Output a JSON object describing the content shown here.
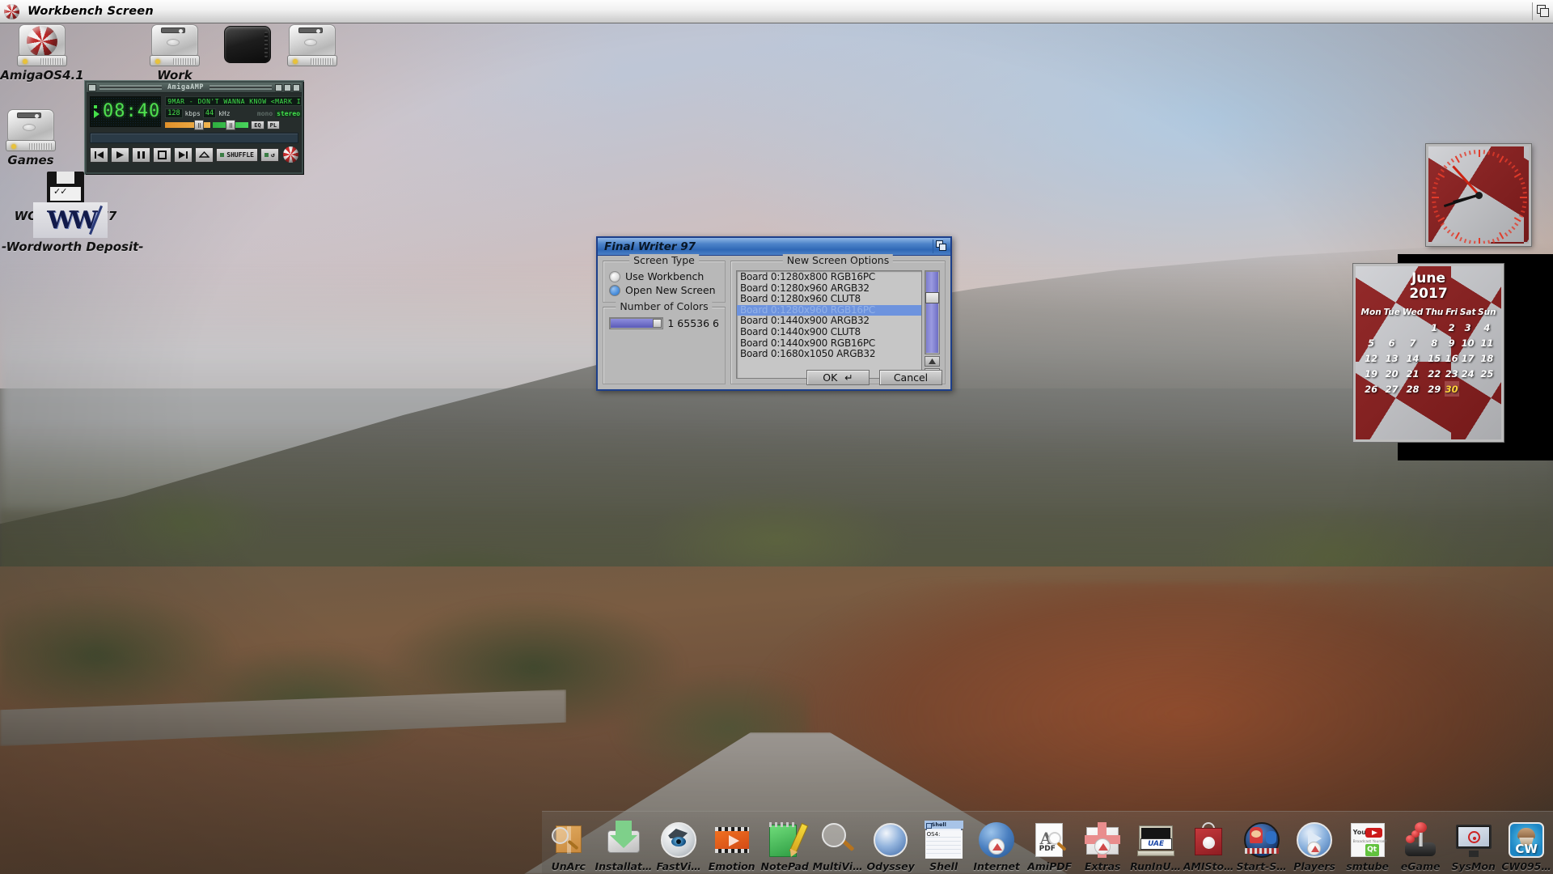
{
  "screen": {
    "title": "Workbench Screen",
    "title_icon": "amiga-ball-icon",
    "depth_gadget": "depth-gadget-icon"
  },
  "desktop_icons": [
    {
      "label": "AmigaOS4.1",
      "icon": "harddisk-amigaball-icon"
    },
    {
      "label": "Work",
      "icon": "harddisk-icon"
    },
    {
      "label": "Games",
      "icon": "harddisk-icon"
    },
    {
      "label": "WORDWORTH7",
      "icon": "floppy-disk-icon"
    },
    {
      "label": "-Wordworth Deposit-",
      "icon": "wordworth-logo-icon"
    }
  ],
  "amigaamp": {
    "window_title": "AmigaAMP",
    "time": "08:40",
    "track": "9MAR - DON'T WANNA KNOW <MARK I",
    "bitrate": "128",
    "bitrate_unit": "kbps",
    "samplerate": "44",
    "samplerate_unit": "kHz",
    "mono_label": "mono",
    "stereo_label": "stereo",
    "eq_label": "EQ",
    "pl_label": "PL",
    "shuffle_label": "SHUFFLE",
    "repeat_label": "↺",
    "buttons": [
      "prev-track",
      "play",
      "pause",
      "stop",
      "next-track",
      "eject"
    ]
  },
  "dialog": {
    "title": "Final Writer 97",
    "screen_type": {
      "legend": "Screen Type",
      "options": [
        {
          "label": "Use Workbench",
          "selected": false
        },
        {
          "label": "Open New Screen",
          "selected": true
        }
      ]
    },
    "number_of_colors": {
      "legend": "Number of Colors",
      "value_text": "1 65536 6"
    },
    "new_screen_options": {
      "legend": "New Screen Options",
      "items": [
        {
          "label": "Board 0:1280x800 RGB16PC",
          "selected": false
        },
        {
          "label": "Board 0:1280x960 ARGB32",
          "selected": false
        },
        {
          "label": "Board 0:1280x960 CLUT8",
          "selected": false
        },
        {
          "label": "Board 0:1280x960 RGB16PC",
          "selected": true
        },
        {
          "label": "Board 0:1440x900 ARGB32",
          "selected": false
        },
        {
          "label": "Board 0:1440x900 CLUT8",
          "selected": false
        },
        {
          "label": "Board 0:1440x900 RGB16PC",
          "selected": false
        },
        {
          "label": "Board 0:1680x1050 ARGB32",
          "selected": false
        }
      ]
    },
    "ok_label": "OK",
    "ok_glyph": "↵",
    "cancel_label": "Cancel"
  },
  "clock": {
    "hour_angle": 255,
    "minute_angle": 252,
    "second_angle": 318
  },
  "calendar": {
    "month": "June",
    "year": "2017",
    "weekdays": [
      "Mon",
      "Tue",
      "Wed",
      "Thu",
      "Fri",
      "Sat",
      "Sun"
    ],
    "weeks": [
      [
        "",
        "",
        "",
        "1",
        "2",
        "3",
        "4"
      ],
      [
        "5",
        "6",
        "7",
        "8",
        "9",
        "10",
        "11"
      ],
      [
        "12",
        "13",
        "14",
        "15",
        "16",
        "17",
        "18"
      ],
      [
        "19",
        "20",
        "21",
        "22",
        "23",
        "24",
        "25"
      ],
      [
        "26",
        "27",
        "28",
        "29",
        "30",
        "",
        ""
      ]
    ],
    "today": "30",
    "today_color": "#ffd23a"
  },
  "dock": {
    "items": [
      {
        "label": "UnArc",
        "icon": "unarc-icon"
      },
      {
        "label": "Installat…",
        "icon": "installer-icon"
      },
      {
        "label": "FastVi…",
        "icon": "fastview-eye-icon"
      },
      {
        "label": "Emotion",
        "icon": "emotion-film-icon"
      },
      {
        "label": "NotePad",
        "icon": "notepad-pencil-icon"
      },
      {
        "label": "MultiVi…",
        "icon": "multiview-magnifier-icon"
      },
      {
        "label": "Odyssey",
        "icon": "odyssey-browser-icon"
      },
      {
        "label": "Shell",
        "icon": "shell-window-icon",
        "window_title": "Shell",
        "window_text": "OS4:"
      },
      {
        "label": "Internet",
        "icon": "internet-globe-icon"
      },
      {
        "label": "AmiPDF",
        "icon": "amipdf-icon",
        "badge": "PDF"
      },
      {
        "label": "Extras",
        "icon": "extras-giftbox-icon"
      },
      {
        "label": "RunInU…",
        "icon": "runinuae-icon",
        "badge": "RunInUAE"
      },
      {
        "label": "AMISto…",
        "icon": "amistore-bag-icon"
      },
      {
        "label": "Start-S…",
        "icon": "start-script-icon"
      },
      {
        "label": "Players",
        "icon": "players-icon"
      },
      {
        "label": "smtube",
        "icon": "smtube-youtube-icon",
        "badge": "Qt"
      },
      {
        "label": "eGame",
        "icon": "joystick-icon"
      },
      {
        "label": "SysMon",
        "icon": "sysmon-monitor-icon"
      },
      {
        "label": "CW095…",
        "icon": "cupcake-icon",
        "badge": "CW"
      }
    ]
  }
}
